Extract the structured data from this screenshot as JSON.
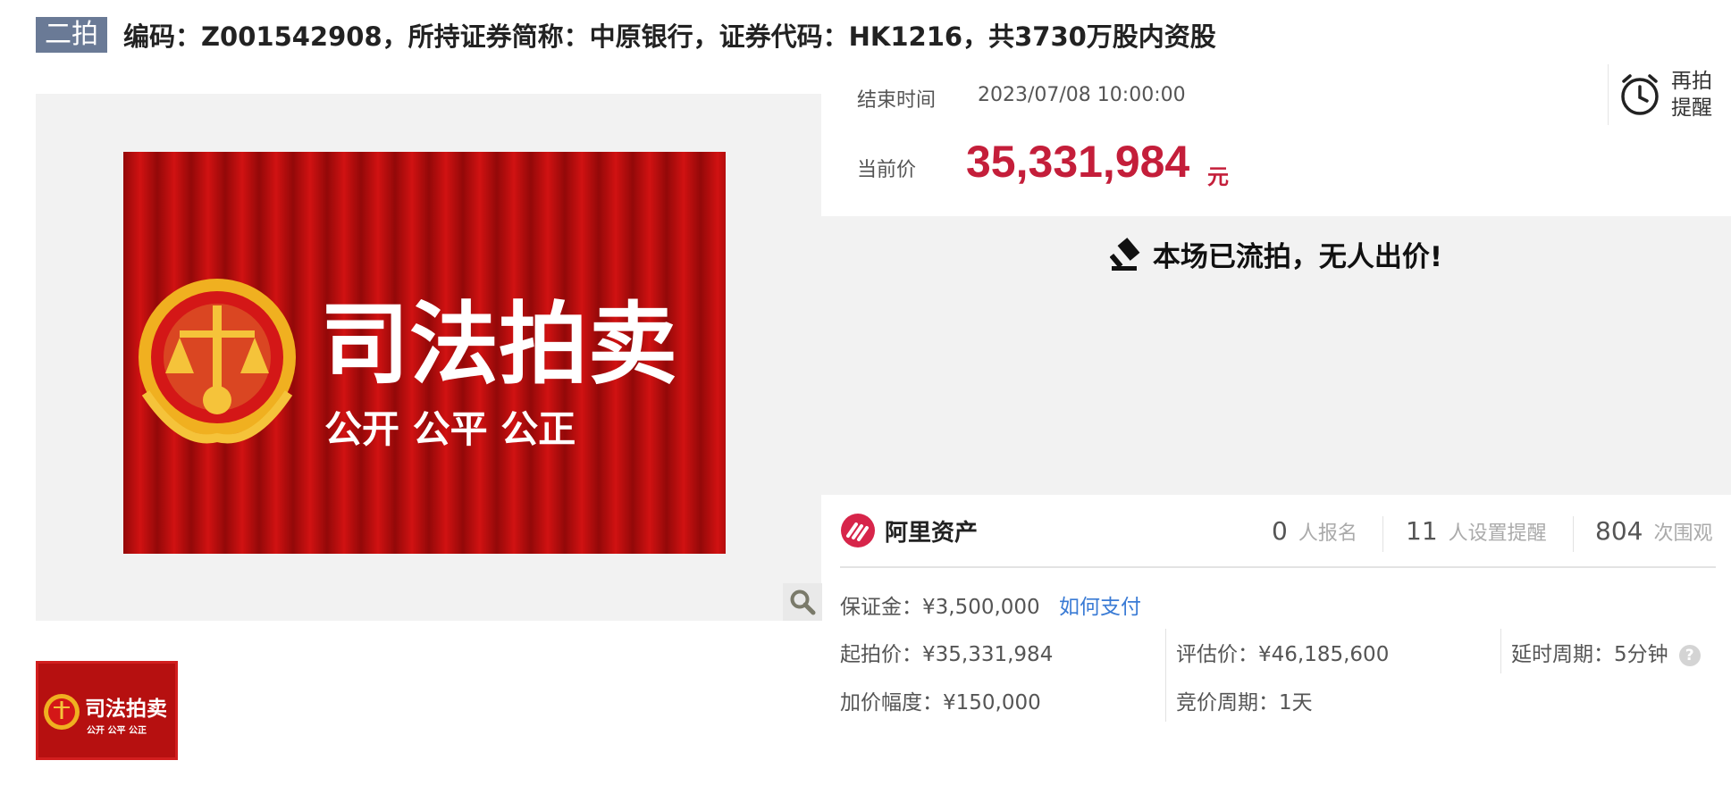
{
  "title": {
    "badge": "二拍",
    "text": "编码：Z001542908，所持证券简称：中原银行，证券代码：HK1216，共3730万股内资股"
  },
  "gallery": {
    "hero_title": "司法拍卖",
    "hero_subtitle": "公开 公平 公正",
    "thumb_title": "司法拍卖",
    "thumb_subtitle": "公开 公平 公正",
    "zoom_icon": "magnifier-icon"
  },
  "auction": {
    "end_label": "结束时间",
    "end_value": "2023/07/08 10:00:00",
    "price_label": "当前价",
    "price_value": "35,331,984",
    "price_unit": "元",
    "remind_label": "再拍提醒",
    "remind_icon": "alarm-clock-icon",
    "status_icon": "gavel-icon",
    "status_text": "本场已流拍，无人出价!"
  },
  "stats": {
    "brand_name": "阿里资产",
    "signups_num": "0",
    "signups_label": "人报名",
    "reminders_num": "11",
    "reminders_label": "人设置提醒",
    "views_num": "804",
    "views_label": "次围观"
  },
  "details": {
    "deposit": "保证金：¥3,500,000",
    "how_to_pay": "如何支付",
    "start_price": "起拍价：¥35,331,984",
    "valuation": "评估价：¥46,185,600",
    "delay_period": "延时周期：5分钟",
    "increment": "加价幅度：¥150,000",
    "bid_period": "竞价周期：1天"
  },
  "colors": {
    "accent_red": "#c41e3a",
    "badge_bg": "#6a7a96",
    "link_blue": "#3a7bd5",
    "panel_gray": "#f2f2f2"
  }
}
